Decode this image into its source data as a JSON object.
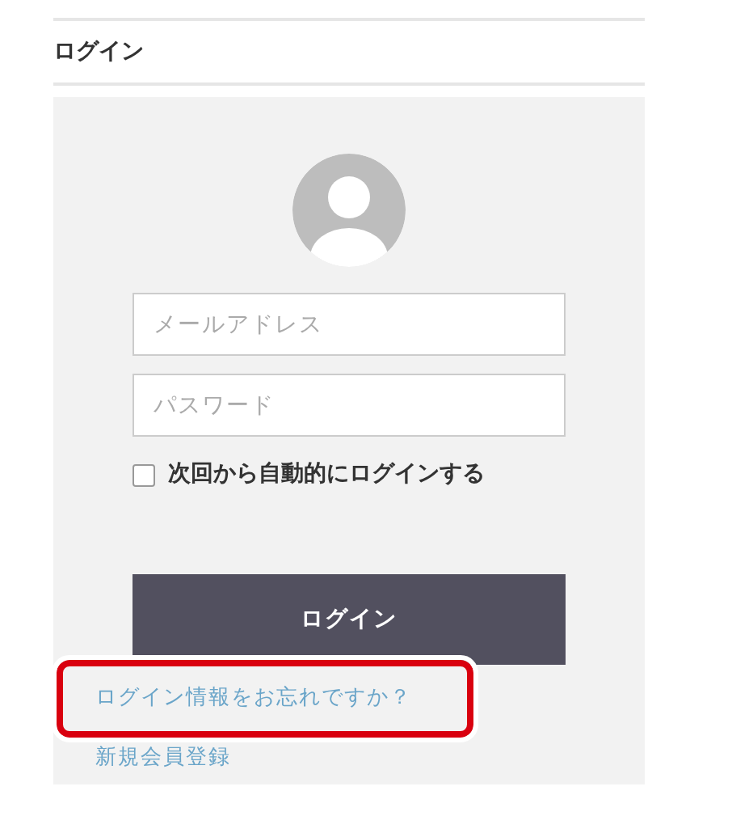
{
  "page_title": "ログイン",
  "login_form": {
    "email": {
      "placeholder": "メールアドレス"
    },
    "password": {
      "placeholder": "パスワード"
    },
    "remember": {
      "label": "次回から自動的にログインする",
      "checked": false
    },
    "submit": "ログイン",
    "forgot_link": {
      "label": "ログイン情報をお忘れですか？",
      "highlighted": true
    },
    "register_link": "新規会員登録"
  }
}
